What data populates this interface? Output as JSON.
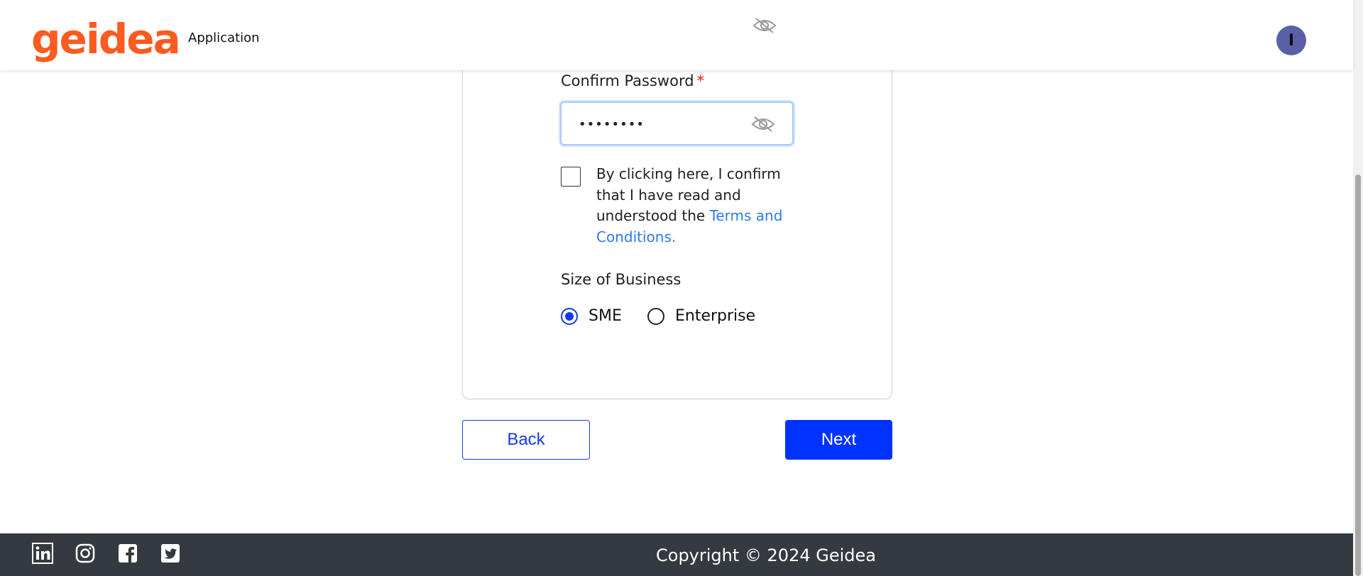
{
  "header": {
    "logo_text": "geidea",
    "app_title": "Application",
    "avatar_initial": "I"
  },
  "form": {
    "confirm_password_label": "Confirm Password",
    "required_marker": "*",
    "confirm_password_value": "••••••••",
    "terms_text": "By clicking here, I confirm that I have read and understood the ",
    "terms_link": "Terms and Conditions.",
    "terms_checked": false,
    "size_of_business_label": "Size of Business",
    "size_options": [
      {
        "label": "SME",
        "selected": true
      },
      {
        "label": "Enterprise",
        "selected": false
      }
    ]
  },
  "actions": {
    "back_label": "Back",
    "next_label": "Next"
  },
  "footer": {
    "copyright": "Copyright © 2024 Geidea",
    "social_icons": [
      "linkedin-icon",
      "instagram-icon",
      "facebook-icon",
      "twitter-icon"
    ]
  },
  "colors": {
    "brand_orange": "#ff5a1f",
    "primary_blue": "#0033ff",
    "link_blue": "#2d7be5",
    "footer_bg": "#343a40",
    "avatar_bg": "#5b5fa8"
  }
}
